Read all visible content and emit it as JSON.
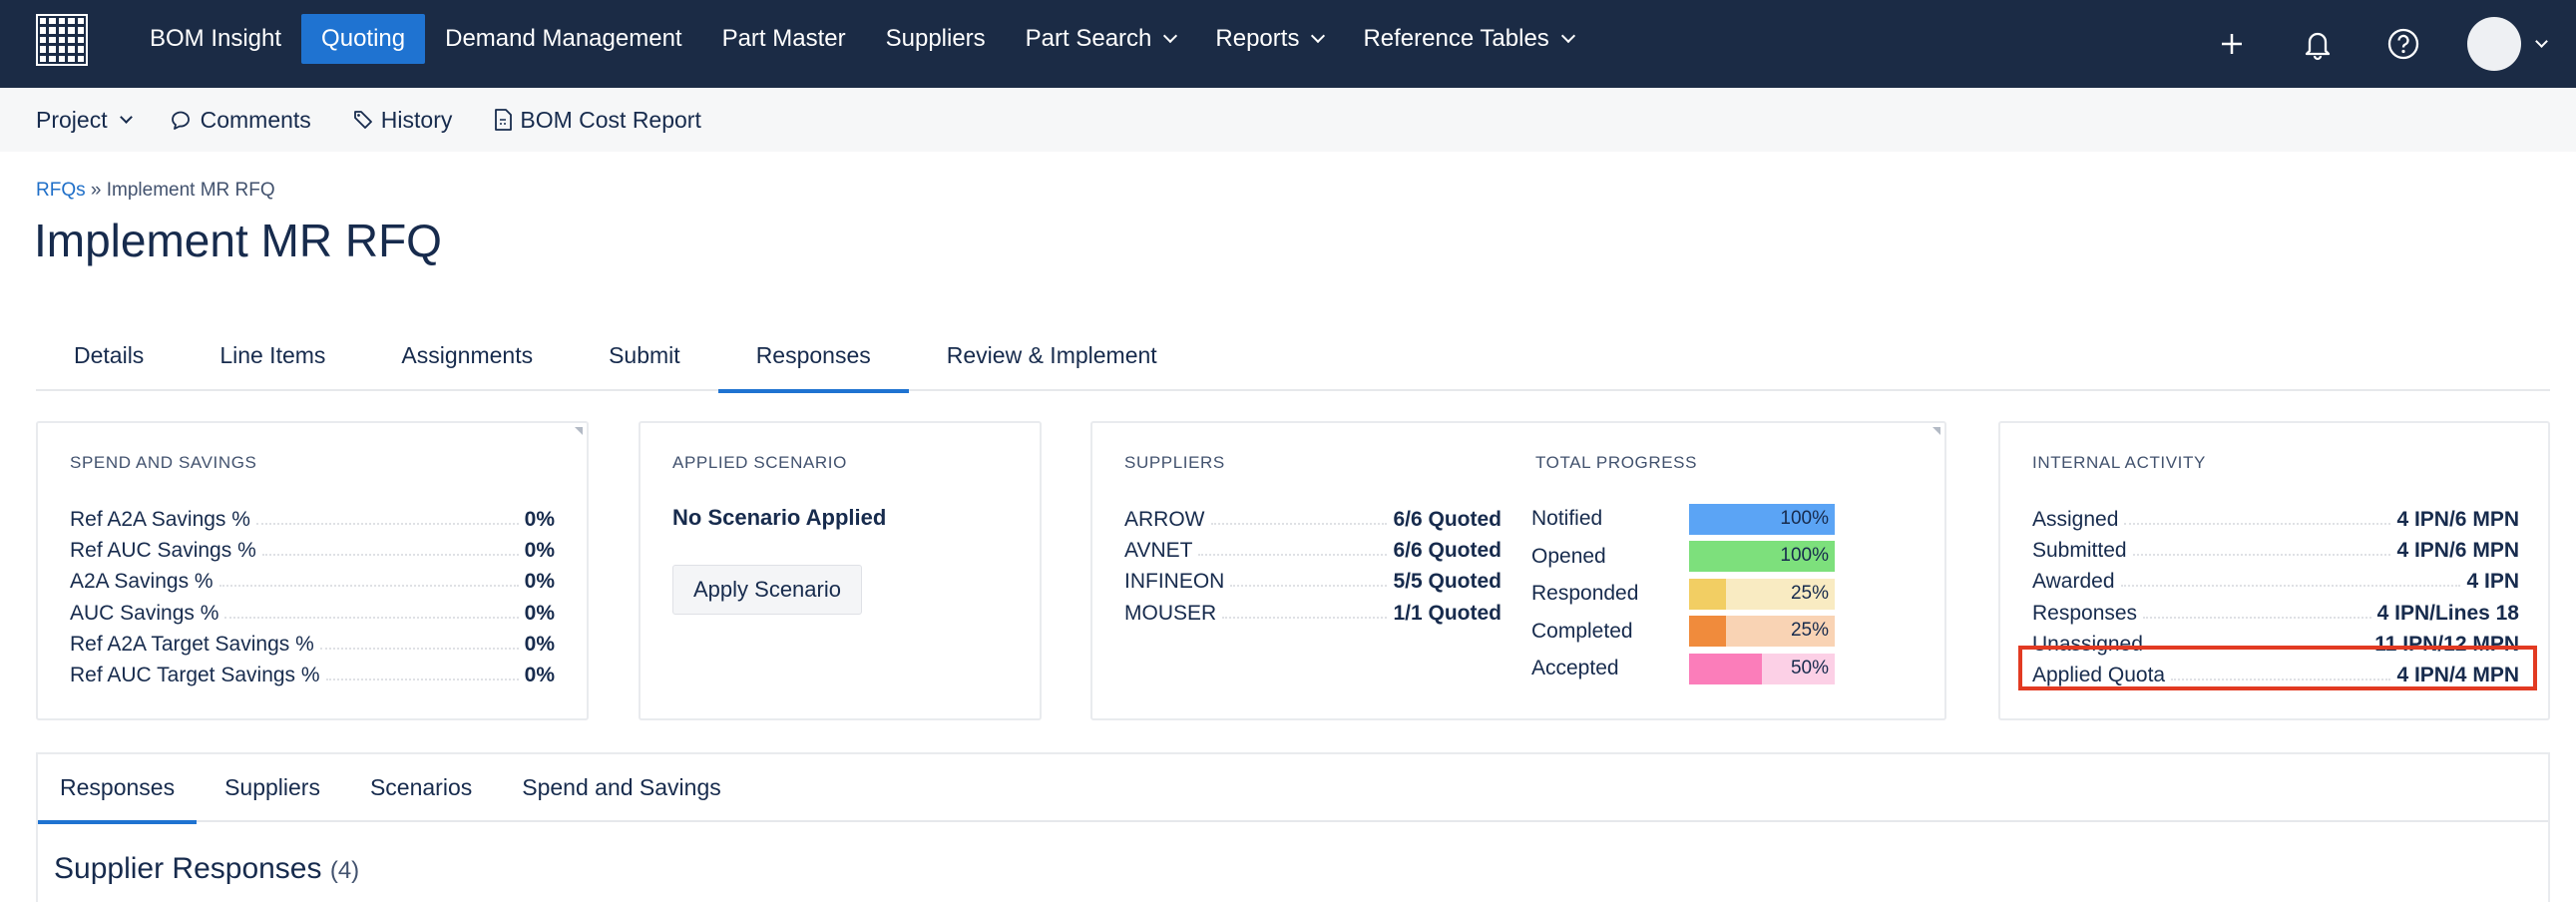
{
  "topnav": {
    "items": [
      {
        "label": "BOM Insight",
        "active": false,
        "dropdown": false
      },
      {
        "label": "Quoting",
        "active": true,
        "dropdown": false
      },
      {
        "label": "Demand Management",
        "active": false,
        "dropdown": false
      },
      {
        "label": "Part Master",
        "active": false,
        "dropdown": false
      },
      {
        "label": "Suppliers",
        "active": false,
        "dropdown": false
      },
      {
        "label": "Part Search",
        "active": false,
        "dropdown": true
      },
      {
        "label": "Reports",
        "active": false,
        "dropdown": true
      },
      {
        "label": "Reference Tables",
        "active": false,
        "dropdown": true
      }
    ],
    "icons": [
      "plus-icon",
      "bell-icon",
      "help-icon",
      "avatar"
    ]
  },
  "subnav": {
    "project": "Project",
    "comments": "Comments",
    "history": "History",
    "bom_cost_report": "BOM Cost Report"
  },
  "breadcrumb": {
    "link": "RFQs",
    "separator": "»",
    "current": "Implement MR RFQ"
  },
  "page_title": "Implement MR RFQ",
  "tabs": [
    {
      "label": "Details",
      "active": false
    },
    {
      "label": "Line Items",
      "active": false
    },
    {
      "label": "Assignments",
      "active": false
    },
    {
      "label": "Submit",
      "active": false
    },
    {
      "label": "Responses",
      "active": true
    },
    {
      "label": "Review & Implement",
      "active": false
    }
  ],
  "spend_savings": {
    "heading": "SPEND AND SAVINGS",
    "rows": [
      {
        "label": "Ref A2A Savings %",
        "value": "0%"
      },
      {
        "label": "Ref AUC Savings %",
        "value": "0%"
      },
      {
        "label": "A2A Savings %",
        "value": "0%"
      },
      {
        "label": "AUC Savings %",
        "value": "0%"
      },
      {
        "label": "Ref A2A Target Savings %",
        "value": "0%"
      },
      {
        "label": "Ref AUC Target Savings %",
        "value": "0%"
      }
    ]
  },
  "applied_scenario": {
    "heading": "APPLIED SCENARIO",
    "status": "No Scenario Applied",
    "button": "Apply Scenario"
  },
  "suppliers": {
    "heading": "SUPPLIERS",
    "rows": [
      {
        "label": "ARROW",
        "value": "6/6 Quoted"
      },
      {
        "label": "AVNET",
        "value": "6/6 Quoted"
      },
      {
        "label": "INFINEON",
        "value": "5/5 Quoted"
      },
      {
        "label": "MOUSER",
        "value": "1/1 Quoted"
      }
    ]
  },
  "total_progress": {
    "heading": "TOTAL PROGRESS",
    "rows": [
      {
        "label": "Notified",
        "percent": 100,
        "text": "100%",
        "color": "#5ba4f5",
        "bg": "#cfe3fb"
      },
      {
        "label": "Opened",
        "percent": 100,
        "text": "100%",
        "color": "#7de07c",
        "bg": "#d6f5d6"
      },
      {
        "label": "Responded",
        "percent": 25,
        "text": "25%",
        "color": "#f2ce63",
        "bg": "#f9ebc2"
      },
      {
        "label": "Completed",
        "percent": 25,
        "text": "25%",
        "color": "#f08b3c",
        "bg": "#f9d3b4"
      },
      {
        "label": "Accepted",
        "percent": 50,
        "text": "50%",
        "color": "#fb7dba",
        "bg": "#fcd0e6"
      }
    ]
  },
  "internal_activity": {
    "heading": "INTERNAL ACTIVITY",
    "rows": [
      {
        "label": "Assigned",
        "value": "4 IPN/6 MPN"
      },
      {
        "label": "Submitted",
        "value": "4 IPN/6 MPN"
      },
      {
        "label": "Awarded",
        "value": "4 IPN"
      },
      {
        "label": "Responses",
        "value": "4 IPN/Lines 18"
      },
      {
        "label": "Unassigned",
        "value": "11 IPN/12 MPN"
      },
      {
        "label": "Applied Quota",
        "value": "4 IPN/4 MPN"
      }
    ]
  },
  "bottom_tabs": [
    {
      "label": "Responses",
      "active": true
    },
    {
      "label": "Suppliers",
      "active": false
    },
    {
      "label": "Scenarios",
      "active": false
    },
    {
      "label": "Spend and Savings",
      "active": false
    }
  ],
  "section": {
    "title": "Supplier Responses",
    "count": "(4)"
  },
  "colors": {
    "nav_bg": "#1b2b45",
    "accent": "#1f73d1",
    "highlight": "#e23a22"
  }
}
